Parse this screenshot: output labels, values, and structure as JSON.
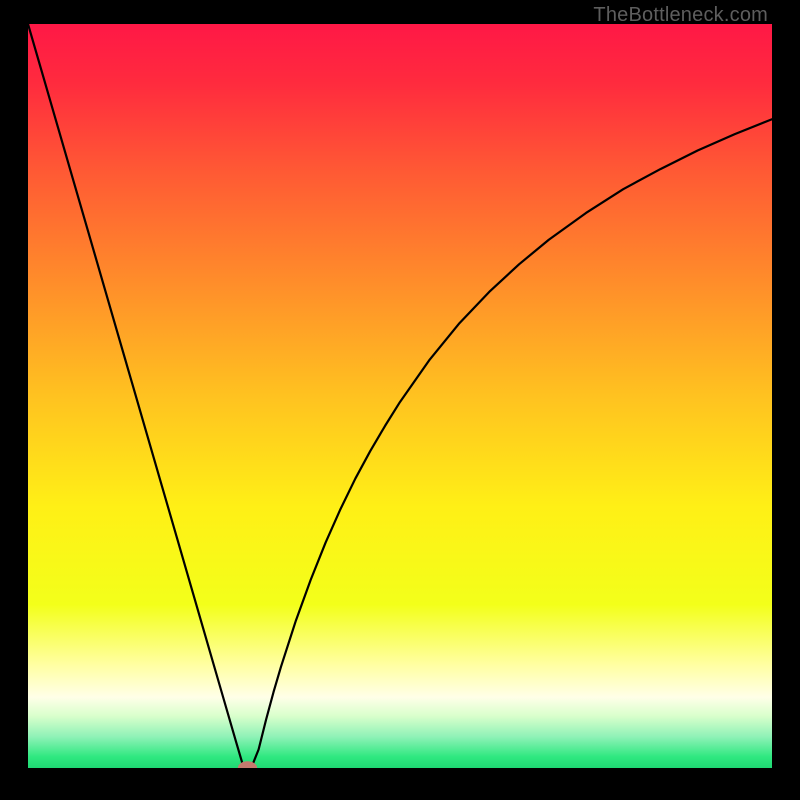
{
  "watermark": "TheBottleneck.com",
  "chart_data": {
    "type": "line",
    "title": "",
    "xlabel": "",
    "ylabel": "",
    "xlim": [
      0,
      100
    ],
    "ylim": [
      0,
      100
    ],
    "grid": false,
    "legend": false,
    "background": {
      "type": "vertical-gradient",
      "stops": [
        {
          "offset": 0.0,
          "color": "#ff1846"
        },
        {
          "offset": 0.08,
          "color": "#ff2b3e"
        },
        {
          "offset": 0.2,
          "color": "#ff5a34"
        },
        {
          "offset": 0.35,
          "color": "#ff8e2a"
        },
        {
          "offset": 0.5,
          "color": "#ffc220"
        },
        {
          "offset": 0.65,
          "color": "#fff016"
        },
        {
          "offset": 0.78,
          "color": "#f3ff1a"
        },
        {
          "offset": 0.86,
          "color": "#ffffa0"
        },
        {
          "offset": 0.905,
          "color": "#ffffe8"
        },
        {
          "offset": 0.93,
          "color": "#d9ffcc"
        },
        {
          "offset": 0.958,
          "color": "#8ff2b7"
        },
        {
          "offset": 0.985,
          "color": "#2fe880"
        },
        {
          "offset": 1.0,
          "color": "#1fd873"
        }
      ]
    },
    "series": [
      {
        "name": "bottleneck-curve",
        "stroke": "#000000",
        "stroke_width": 2.2,
        "x": [
          0,
          2,
          4,
          6,
          8,
          10,
          12,
          14,
          16,
          18,
          20,
          22,
          24,
          26,
          28,
          29,
          30,
          31,
          32,
          33,
          34,
          36,
          38,
          40,
          42,
          44,
          46,
          48,
          50,
          54,
          58,
          62,
          66,
          70,
          75,
          80,
          85,
          90,
          95,
          100
        ],
        "y": [
          100,
          93.1,
          86.2,
          79.3,
          72.4,
          65.5,
          58.6,
          51.7,
          44.8,
          37.9,
          31.0,
          24.1,
          17.2,
          10.3,
          3.4,
          0.0,
          0.0,
          2.5,
          6.5,
          10.2,
          13.6,
          19.8,
          25.3,
          30.3,
          34.8,
          38.9,
          42.6,
          46.0,
          49.2,
          54.9,
          59.8,
          64.0,
          67.7,
          71.0,
          74.6,
          77.8,
          80.5,
          83.0,
          85.2,
          87.2
        ]
      }
    ],
    "marker": {
      "name": "optimal-point",
      "cx": 29.5,
      "cy": 0.0,
      "rx": 1.3,
      "ry": 0.9,
      "fill": "#c57a6e"
    }
  }
}
